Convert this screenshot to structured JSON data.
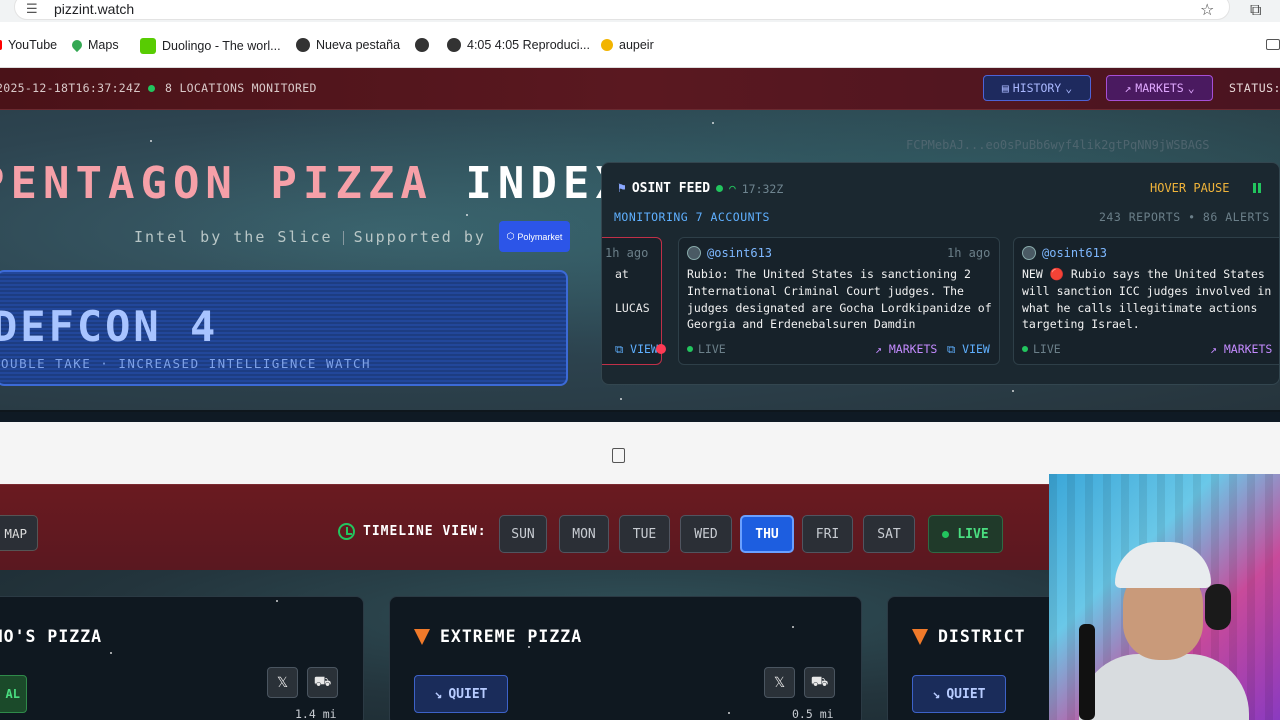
{
  "browser": {
    "url": "pizzint.watch",
    "bookmarks": [
      {
        "label": "YouTube",
        "color": "#ff0000"
      },
      {
        "label": "Maps",
        "color": "#34a853"
      },
      {
        "label": "Duolingo - The worl...",
        "color": "#58cc02"
      },
      {
        "label": "Nueva pestaña",
        "color": "#5f6368"
      },
      {
        "label": "",
        "color": "#5f6368"
      },
      {
        "label": "4:05 4:05 Reproduci...",
        "color": "#5f6368"
      },
      {
        "label": "aupeir",
        "color": "#f2b400"
      }
    ]
  },
  "topbar": {
    "timestamp": "2025-12-18T16:37:24Z",
    "locations": "8 LOCATIONS MONITORED",
    "history_label": "HISTORY",
    "markets_label": "MARKETS",
    "status_label": "STATUS:"
  },
  "hero": {
    "title_pink": "PENTAGON PIZZA",
    "title_white": "INDEX",
    "tagline_left": "Intel by the Slice",
    "tagline_right": "Supported by",
    "sponsor": "Polymarket",
    "defcon_level": "DEFCON 4",
    "defcon_desc": "DOUBLE TAKE · INCREASED INTELLIGENCE WATCH",
    "hash": "FCPMebAJ...eo0sPuBb6wyf4lik2gtPqNN9jWSBAGS"
  },
  "feed": {
    "title": "OSINT FEED",
    "time": "17:32Z",
    "hover_pause": "HOVER PAUSE",
    "monitoring": "MONITORING 7 ACCOUNTS",
    "reports": "243 REPORTS • 86 ALERTS",
    "cards": [
      {
        "user": "",
        "ago": "1h ago",
        "text": "at ... LUCAS",
        "markets": "",
        "view": "VIEW"
      },
      {
        "user": "@osint613",
        "ago": "1h ago",
        "text": "Rubio: The United States is sanctioning 2 International Criminal Court judges. The judges designated are Gocha Lordkipanidze of Georgia and Erdenebalsuren Damdin",
        "live": "LIVE",
        "markets": "MARKETS",
        "view": "VIEW"
      },
      {
        "user": "@osint613",
        "ago": "",
        "text": "NEW 🔴 Rubio says the United States will sanction ICC judges involved in what he calls illegitimate actions targeting Israel.",
        "live": "LIVE",
        "markets": "MARKETS",
        "view": ""
      }
    ]
  },
  "timeline": {
    "map_label": "MAP",
    "label": "TIMELINE VIEW:",
    "days": [
      "SUN",
      "MON",
      "TUE",
      "WED",
      "THU",
      "FRI",
      "SAT"
    ],
    "active_day": "THU",
    "live_label": "LIVE"
  },
  "stores": [
    {
      "name": "DOMINO'S PIZZA",
      "status": "AL",
      "distance": "1.4 mi"
    },
    {
      "name": "EXTREME PIZZA",
      "status": "QUIET",
      "distance": "0.5 mi"
    },
    {
      "name": "DISTRICT",
      "status": "QUIET",
      "distance": ""
    }
  ]
}
